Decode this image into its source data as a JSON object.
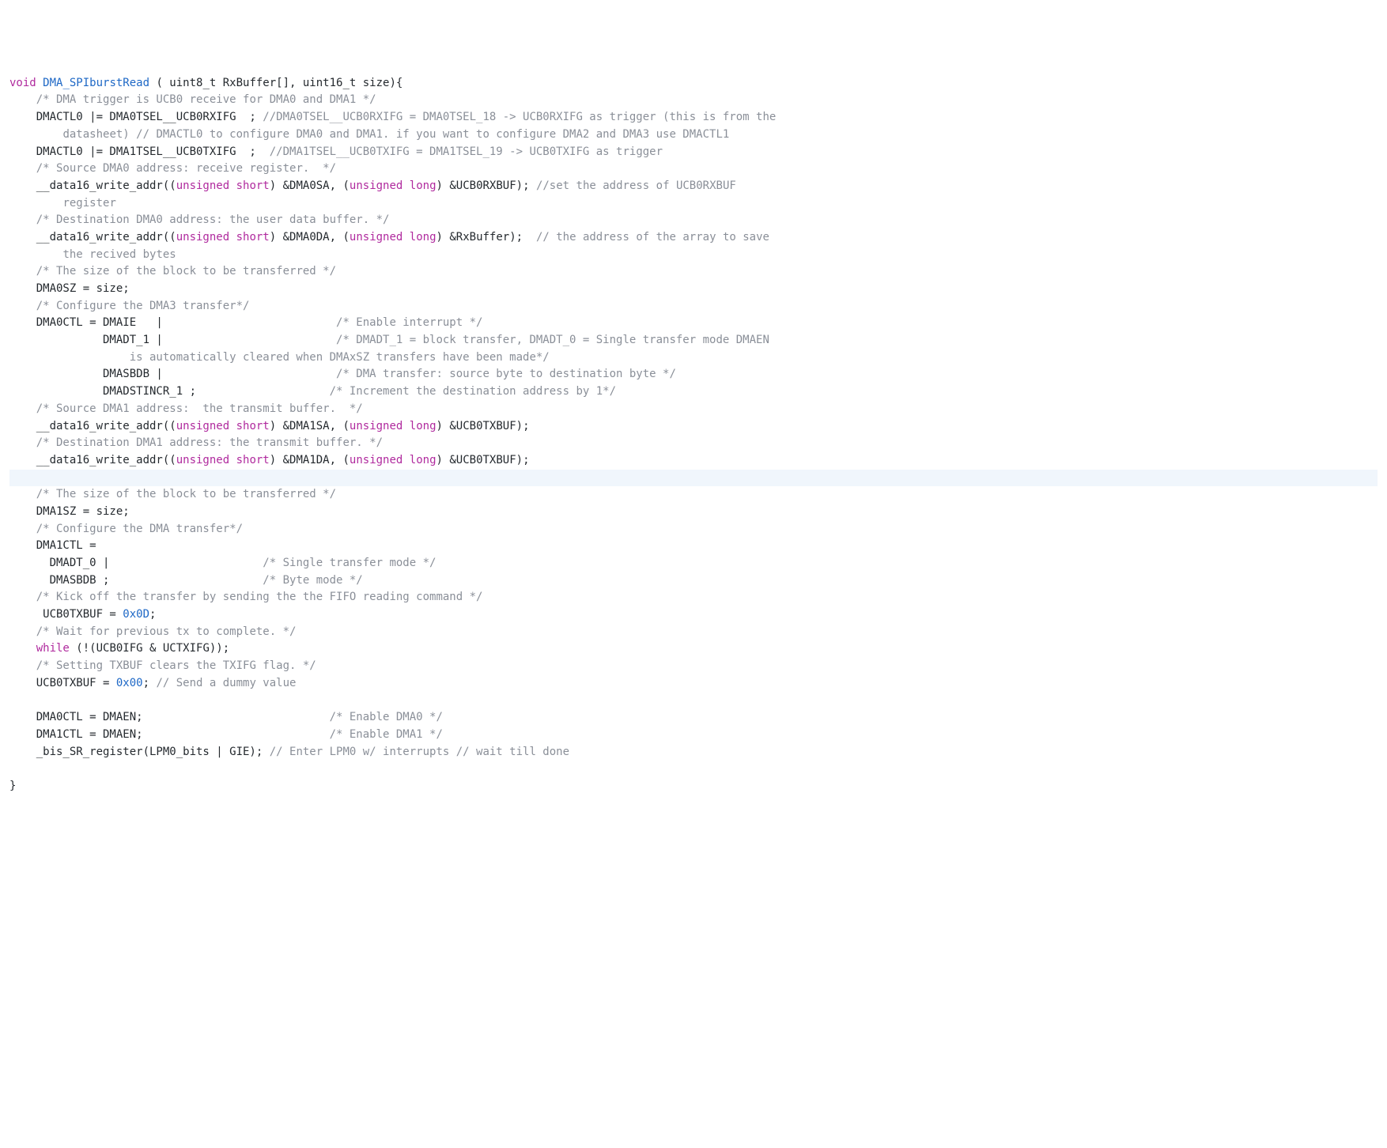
{
  "code": {
    "lines": [
      {
        "seg": [
          {
            "t": "kw",
            "v": "void"
          },
          {
            "t": "",
            "v": " "
          },
          {
            "t": "fn",
            "v": "DMA_SPIburstRead"
          },
          {
            "t": "",
            "v": " ( uint8_t RxBuffer[], uint16_t size){"
          }
        ]
      },
      {
        "seg": [
          {
            "t": "",
            "v": "    "
          },
          {
            "t": "c",
            "v": "/* DMA trigger is UCB0 receive for DMA0 and DMA1 */"
          }
        ]
      },
      {
        "seg": [
          {
            "t": "",
            "v": "    DMACTL0 |= DMA0TSEL__UCB0RXIFG  ; "
          },
          {
            "t": "c",
            "v": "//DMA0TSEL__UCB0RXIFG = DMA0TSEL_18 -> UCB0RXIFG as trigger (this is from the"
          }
        ]
      },
      {
        "seg": [
          {
            "t": "",
            "v": "        "
          },
          {
            "t": "c",
            "v": "datasheet) // DMACTL0 to configure DMA0 and DMA1. if you want to configure DMA2 and DMA3 use DMACTL1"
          }
        ]
      },
      {
        "seg": [
          {
            "t": "",
            "v": "    DMACTL0 |= DMA1TSEL__UCB0TXIFG  ;  "
          },
          {
            "t": "c",
            "v": "//DMA1TSEL__UCB0TXIFG = DMA1TSEL_19 -> UCB0TXIFG as trigger"
          }
        ]
      },
      {
        "seg": [
          {
            "t": "",
            "v": "    "
          },
          {
            "t": "c",
            "v": "/* Source DMA0 address: receive register.  */"
          }
        ]
      },
      {
        "seg": [
          {
            "t": "",
            "v": "    __data16_write_addr(("
          },
          {
            "t": "kw",
            "v": "unsigned"
          },
          {
            "t": "",
            "v": " "
          },
          {
            "t": "ty",
            "v": "short"
          },
          {
            "t": "",
            "v": ") &DMA0SA, ("
          },
          {
            "t": "kw",
            "v": "unsigned"
          },
          {
            "t": "",
            "v": " "
          },
          {
            "t": "ty",
            "v": "long"
          },
          {
            "t": "",
            "v": ") &UCB0RXBUF); "
          },
          {
            "t": "c",
            "v": "//set the address of UCB0RXBUF"
          }
        ]
      },
      {
        "seg": [
          {
            "t": "",
            "v": "        "
          },
          {
            "t": "c",
            "v": "register"
          }
        ]
      },
      {
        "seg": [
          {
            "t": "",
            "v": "    "
          },
          {
            "t": "c",
            "v": "/* Destination DMA0 address: the user data buffer. */"
          }
        ]
      },
      {
        "seg": [
          {
            "t": "",
            "v": "    __data16_write_addr(("
          },
          {
            "t": "kw",
            "v": "unsigned"
          },
          {
            "t": "",
            "v": " "
          },
          {
            "t": "ty",
            "v": "short"
          },
          {
            "t": "",
            "v": ") &DMA0DA, ("
          },
          {
            "t": "kw",
            "v": "unsigned"
          },
          {
            "t": "",
            "v": " "
          },
          {
            "t": "ty",
            "v": "long"
          },
          {
            "t": "",
            "v": ") &RxBuffer);  "
          },
          {
            "t": "c",
            "v": "// the address of the array to save"
          }
        ]
      },
      {
        "seg": [
          {
            "t": "",
            "v": "        "
          },
          {
            "t": "c",
            "v": "the recived bytes"
          }
        ]
      },
      {
        "seg": [
          {
            "t": "",
            "v": "    "
          },
          {
            "t": "c",
            "v": "/* The size of the block to be transferred */"
          }
        ]
      },
      {
        "seg": [
          {
            "t": "",
            "v": "    DMA0SZ = size;"
          }
        ]
      },
      {
        "seg": [
          {
            "t": "",
            "v": "    "
          },
          {
            "t": "c",
            "v": "/* Configure the DMA3 transfer*/"
          }
        ]
      },
      {
        "seg": [
          {
            "t": "",
            "v": "    DMA0CTL = DMAIE   |                          "
          },
          {
            "t": "c",
            "v": "/* Enable interrupt */"
          }
        ]
      },
      {
        "seg": [
          {
            "t": "",
            "v": "              DMADT_1 |                          "
          },
          {
            "t": "c",
            "v": "/* DMADT_1 = block transfer, DMADT_0 = Single transfer mode DMAEN"
          }
        ]
      },
      {
        "seg": [
          {
            "t": "",
            "v": "                  "
          },
          {
            "t": "c",
            "v": "is automatically cleared when DMAxSZ transfers have been made*/"
          }
        ]
      },
      {
        "seg": [
          {
            "t": "",
            "v": "              DMASBDB |                          "
          },
          {
            "t": "c",
            "v": "/* DMA transfer: source byte to destination byte */"
          }
        ]
      },
      {
        "seg": [
          {
            "t": "",
            "v": "              DMADSTINCR_1 ;                    "
          },
          {
            "t": "c",
            "v": "/* Increment the destination address by 1*/"
          }
        ]
      },
      {
        "seg": [
          {
            "t": "",
            "v": "    "
          },
          {
            "t": "c",
            "v": "/* Source DMA1 address:  the transmit buffer.  */"
          }
        ]
      },
      {
        "seg": [
          {
            "t": "",
            "v": "    __data16_write_addr(("
          },
          {
            "t": "kw",
            "v": "unsigned"
          },
          {
            "t": "",
            "v": " "
          },
          {
            "t": "ty",
            "v": "short"
          },
          {
            "t": "",
            "v": ") &DMA1SA, ("
          },
          {
            "t": "kw",
            "v": "unsigned"
          },
          {
            "t": "",
            "v": " "
          },
          {
            "t": "ty",
            "v": "long"
          },
          {
            "t": "",
            "v": ") &UCB0TXBUF);"
          }
        ]
      },
      {
        "seg": [
          {
            "t": "",
            "v": "    "
          },
          {
            "t": "c",
            "v": "/* Destination DMA1 address: the transmit buffer. */"
          }
        ]
      },
      {
        "seg": [
          {
            "t": "",
            "v": "    __data16_write_addr(("
          },
          {
            "t": "kw",
            "v": "unsigned"
          },
          {
            "t": "",
            "v": " "
          },
          {
            "t": "ty",
            "v": "short"
          },
          {
            "t": "",
            "v": ") &DMA1DA, ("
          },
          {
            "t": "kw",
            "v": "unsigned"
          },
          {
            "t": "",
            "v": " "
          },
          {
            "t": "ty",
            "v": "long"
          },
          {
            "t": "",
            "v": ") &UCB0TXBUF);"
          }
        ]
      },
      {
        "hl": true,
        "seg": [
          {
            "t": "",
            "v": " "
          }
        ]
      },
      {
        "seg": [
          {
            "t": "",
            "v": "    "
          },
          {
            "t": "c",
            "v": "/* The size of the block to be transferred */"
          }
        ]
      },
      {
        "seg": [
          {
            "t": "",
            "v": "    DMA1SZ = size;"
          }
        ]
      },
      {
        "seg": [
          {
            "t": "",
            "v": "    "
          },
          {
            "t": "c",
            "v": "/* Configure the DMA transfer*/"
          }
        ]
      },
      {
        "seg": [
          {
            "t": "",
            "v": "    DMA1CTL ="
          }
        ]
      },
      {
        "seg": [
          {
            "t": "",
            "v": "      DMADT_0 |                       "
          },
          {
            "t": "c",
            "v": "/* Single transfer mode */"
          }
        ]
      },
      {
        "seg": [
          {
            "t": "",
            "v": "      DMASBDB ;                       "
          },
          {
            "t": "c",
            "v": "/* Byte mode */"
          }
        ]
      },
      {
        "seg": [
          {
            "t": "",
            "v": "    "
          },
          {
            "t": "c",
            "v": "/* Kick off the transfer by sending the the FIFO reading command */"
          }
        ]
      },
      {
        "seg": [
          {
            "t": "",
            "v": "     UCB0TXBUF = "
          },
          {
            "t": "n",
            "v": "0x0D"
          },
          {
            "t": "",
            "v": ";"
          }
        ]
      },
      {
        "seg": [
          {
            "t": "",
            "v": "    "
          },
          {
            "t": "c",
            "v": "/* Wait for previous tx to complete. */"
          }
        ]
      },
      {
        "seg": [
          {
            "t": "",
            "v": "    "
          },
          {
            "t": "kw",
            "v": "while"
          },
          {
            "t": "",
            "v": " (!(UCB0IFG & UCTXIFG));"
          }
        ]
      },
      {
        "seg": [
          {
            "t": "",
            "v": "    "
          },
          {
            "t": "c",
            "v": "/* Setting TXBUF clears the TXIFG flag. */"
          }
        ]
      },
      {
        "seg": [
          {
            "t": "",
            "v": "    UCB0TXBUF = "
          },
          {
            "t": "n",
            "v": "0x00"
          },
          {
            "t": "",
            "v": "; "
          },
          {
            "t": "c",
            "v": "// Send a dummy value"
          }
        ]
      },
      {
        "seg": [
          {
            "t": "",
            "v": " "
          }
        ]
      },
      {
        "seg": [
          {
            "t": "",
            "v": "    DMA0CTL = DMAEN;                            "
          },
          {
            "t": "c",
            "v": "/* Enable DMA0 */"
          }
        ]
      },
      {
        "seg": [
          {
            "t": "",
            "v": "    DMA1CTL = DMAEN;                            "
          },
          {
            "t": "c",
            "v": "/* Enable DMA1 */"
          }
        ]
      },
      {
        "seg": [
          {
            "t": "",
            "v": "    _bis_SR_register(LPM0_bits | GIE); "
          },
          {
            "t": "c",
            "v": "// Enter LPM0 w/ interrupts // wait till done"
          }
        ]
      },
      {
        "seg": [
          {
            "t": "",
            "v": " "
          }
        ]
      },
      {
        "seg": [
          {
            "t": "",
            "v": "}"
          }
        ]
      }
    ]
  }
}
